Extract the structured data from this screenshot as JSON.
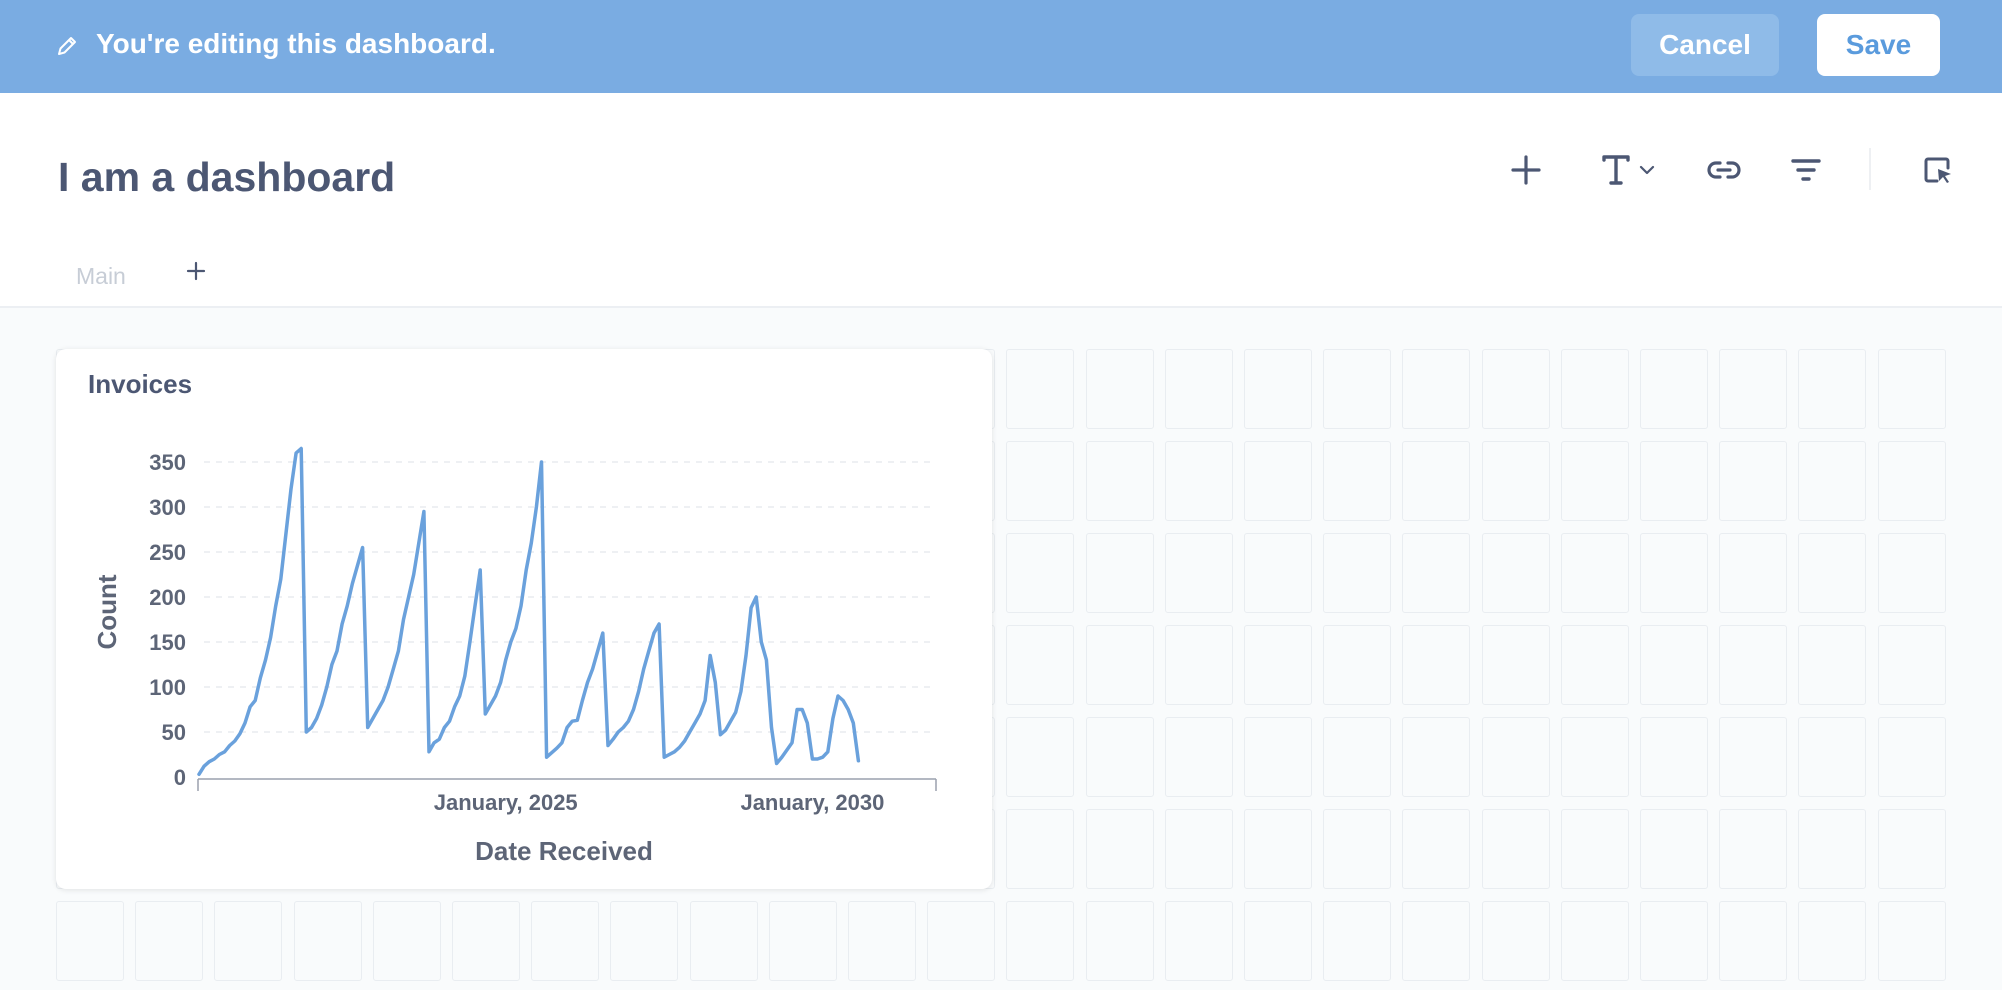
{
  "edit_banner": {
    "message": "You're editing this dashboard.",
    "cancel_label": "Cancel",
    "save_label": "Save",
    "icon": "pencil-icon"
  },
  "header": {
    "title": "I am a dashboard",
    "toolbar_icons": [
      "add-icon",
      "text-icon",
      "link-icon",
      "filter-icon",
      "select-cursor-icon"
    ]
  },
  "tabs": {
    "items": [
      {
        "label": "Main"
      }
    ],
    "add_icon": "plus-icon"
  },
  "colors": {
    "banner": "#7aace2",
    "accent": "#5a9bdd",
    "series": "#6aa1dc",
    "text": "#4c5773"
  },
  "card": {
    "title": "Invoices",
    "chart_data": {
      "type": "line",
      "title": "Invoices",
      "xlabel": "Date Received",
      "ylabel": "Count",
      "ylim": [
        0,
        350
      ],
      "yticks": [
        0,
        50,
        100,
        150,
        200,
        250,
        300,
        350
      ],
      "xticks": [
        "January, 2025",
        "January, 2030"
      ],
      "grid": true,
      "series": [
        {
          "x": [
            "2020-01",
            "2020-02",
            "2020-03",
            "2020-04",
            "2020-05",
            "2020-06",
            "2020-07",
            "2020-08",
            "2020-09",
            "2020-10",
            "2020-11",
            "2020-12",
            "2021-01",
            "2021-02",
            "2021-03",
            "2021-04",
            "2021-05",
            "2021-06",
            "2021-07",
            "2021-08",
            "2021-09",
            "2021-10",
            "2021-11",
            "2021-12",
            "2022-01",
            "2022-02",
            "2022-03",
            "2022-04",
            "2022-05",
            "2022-06",
            "2022-07",
            "2022-08",
            "2022-09",
            "2022-10",
            "2022-11",
            "2022-12",
            "2023-01",
            "2023-02",
            "2023-03",
            "2023-04",
            "2023-05",
            "2023-06",
            "2023-07",
            "2023-08",
            "2023-09",
            "2023-10",
            "2023-11",
            "2023-12",
            "2024-01",
            "2024-02",
            "2024-03",
            "2024-04",
            "2024-05",
            "2024-06",
            "2024-07",
            "2024-08",
            "2024-09",
            "2024-10",
            "2024-11",
            "2024-12",
            "2025-01",
            "2025-02",
            "2025-03",
            "2025-04",
            "2025-05",
            "2025-06",
            "2025-07",
            "2025-08",
            "2025-09",
            "2025-10",
            "2025-11",
            "2025-12",
            "2026-01",
            "2026-02",
            "2026-03",
            "2026-04",
            "2026-05",
            "2026-06",
            "2026-07",
            "2026-08",
            "2026-09",
            "2026-10",
            "2026-11",
            "2026-12",
            "2027-01",
            "2027-02",
            "2027-03",
            "2027-04",
            "2027-05",
            "2027-06",
            "2027-07",
            "2027-08",
            "2027-09",
            "2027-10",
            "2027-11",
            "2027-12",
            "2028-01",
            "2028-02",
            "2028-03",
            "2028-04",
            "2028-05",
            "2028-06",
            "2028-07",
            "2028-08",
            "2028-09",
            "2028-10",
            "2028-11",
            "2028-12",
            "2029-01",
            "2029-02",
            "2029-03",
            "2029-04",
            "2029-05",
            "2029-06",
            "2029-07",
            "2029-08",
            "2029-09",
            "2029-10",
            "2029-11",
            "2029-12",
            "2030-01",
            "2030-02",
            "2030-03",
            "2030-04",
            "2030-05",
            "2030-06",
            "2030-07",
            "2030-08",
            "2030-09",
            "2030-10",
            "2030-11",
            "2030-12",
            "2031-01",
            "2031-02",
            "2031-03",
            "2031-04",
            "2031-05",
            "2031-06",
            "2031-07",
            "2031-08",
            "2031-09",
            "2031-10",
            "2031-11",
            "2031-12"
          ],
          "values": [
            3,
            12,
            17,
            20,
            25,
            28,
            35,
            40,
            48,
            60,
            78,
            85,
            110,
            130,
            155,
            190,
            220,
            270,
            320,
            360,
            365,
            50,
            55,
            65,
            80,
            100,
            125,
            140,
            170,
            190,
            215,
            235,
            255,
            55,
            65,
            75,
            85,
            100,
            120,
            140,
            175,
            200,
            225,
            260,
            295,
            28,
            38,
            42,
            55,
            62,
            78,
            90,
            112,
            150,
            190,
            230,
            70,
            80,
            90,
            105,
            130,
            150,
            165,
            190,
            230,
            260,
            300,
            350,
            22,
            27,
            32,
            38,
            55,
            62,
            63,
            85,
            105,
            120,
            140,
            160,
            35,
            42,
            50,
            55,
            62,
            75,
            95,
            120,
            140,
            160,
            170,
            22,
            25,
            28,
            33,
            40,
            50,
            60,
            70,
            85,
            135,
            105,
            47,
            52,
            62,
            72,
            95,
            135,
            188,
            200,
            150,
            130,
            55,
            15,
            22,
            30,
            38,
            75,
            75,
            60,
            20,
            20,
            22,
            28,
            65,
            90,
            85,
            75,
            60,
            18
          ]
        }
      ]
    }
  }
}
